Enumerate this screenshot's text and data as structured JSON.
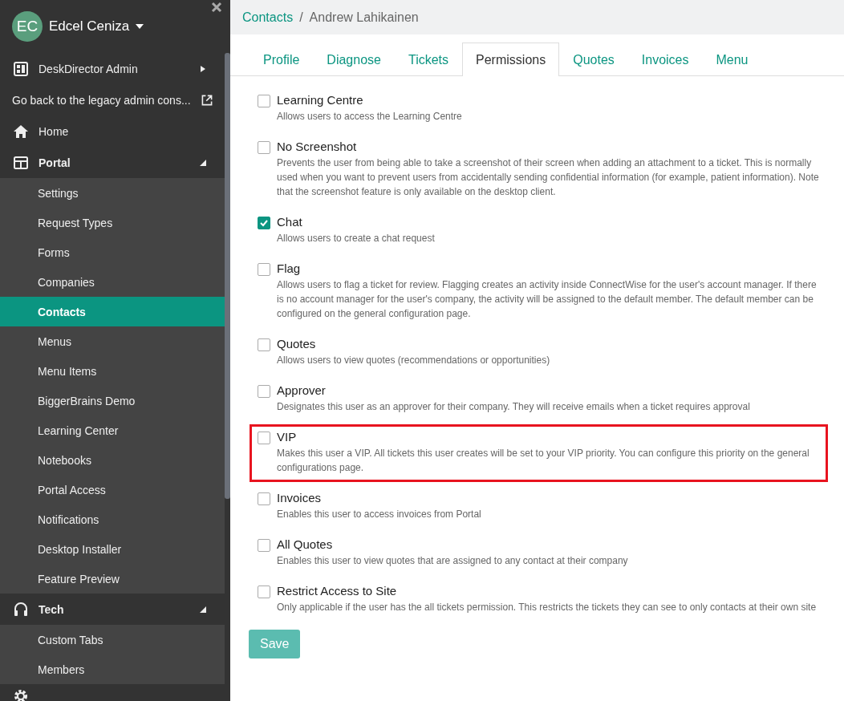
{
  "sidebar": {
    "user": {
      "initials": "EC",
      "name": "Edcel Ceniza"
    },
    "items": [
      {
        "kind": "submenu",
        "label": "DeskDirector Admin"
      },
      {
        "kind": "external",
        "label": "Go back to the legacy admin cons..."
      },
      {
        "kind": "link",
        "label": "Home"
      },
      {
        "kind": "section",
        "label": "Portal",
        "expanded": true,
        "children": [
          {
            "label": "Settings",
            "selected": false
          },
          {
            "label": "Request Types",
            "selected": false
          },
          {
            "label": "Forms",
            "selected": false
          },
          {
            "label": "Companies",
            "selected": false
          },
          {
            "label": "Contacts",
            "selected": true
          },
          {
            "label": "Menus",
            "selected": false
          },
          {
            "label": "Menu Items",
            "selected": false
          },
          {
            "label": "BiggerBrains Demo",
            "selected": false
          },
          {
            "label": "Learning Center",
            "selected": false
          },
          {
            "label": "Notebooks",
            "selected": false
          },
          {
            "label": "Portal Access",
            "selected": false
          },
          {
            "label": "Notifications",
            "selected": false
          },
          {
            "label": "Desktop Installer",
            "selected": false
          },
          {
            "label": "Feature Preview",
            "selected": false
          }
        ]
      },
      {
        "kind": "section",
        "label": "Tech",
        "expanded": true,
        "children": [
          {
            "label": "Custom Tabs",
            "selected": false
          },
          {
            "label": "Members",
            "selected": false
          }
        ]
      }
    ]
  },
  "breadcrumb": {
    "link": "Contacts",
    "separator": "/",
    "current": "Andrew Lahikainen"
  },
  "tabs": [
    {
      "label": "Profile",
      "selected": false
    },
    {
      "label": "Diagnose",
      "selected": false
    },
    {
      "label": "Tickets",
      "selected": false
    },
    {
      "label": "Permissions",
      "selected": true
    },
    {
      "label": "Quotes",
      "selected": false
    },
    {
      "label": "Invoices",
      "selected": false
    },
    {
      "label": "Menu",
      "selected": false
    }
  ],
  "permissions": [
    {
      "title": "Learning Centre",
      "description": "Allows users to access the Learning Centre",
      "checked": false,
      "highlighted": false
    },
    {
      "title": "No Screenshot",
      "description": "Prevents the user from being able to take a screenshot of their screen when adding an attachment to a ticket. This is normally used when you want to prevent users from accidentally sending confidential information (for example, patient information). Note that the screenshot feature is only available on the desktop client.",
      "checked": false,
      "highlighted": false
    },
    {
      "title": "Chat",
      "description": "Allows users to create a chat request",
      "checked": true,
      "highlighted": false
    },
    {
      "title": "Flag",
      "description": "Allows users to flag a ticket for review. Flagging creates an activity inside ConnectWise for the user's account manager. If there is no account manager for the user's company, the activity will be assigned to the default member. The default member can be configured on the general configuration page.",
      "checked": false,
      "highlighted": false
    },
    {
      "title": "Quotes",
      "description": "Allows users to view quotes (recommendations or opportunities)",
      "checked": false,
      "highlighted": false
    },
    {
      "title": "Approver",
      "description": "Designates this user as an approver for their company. They will receive emails when a ticket requires approval",
      "checked": false,
      "highlighted": false
    },
    {
      "title": "VIP",
      "description": "Makes this user a VIP. All tickets this user creates will be set to your VIP priority. You can configure this priority on the general configurations page.",
      "checked": false,
      "highlighted": true
    },
    {
      "title": "Invoices",
      "description": "Enables this user to access invoices from Portal",
      "checked": false,
      "highlighted": false
    },
    {
      "title": "All Quotes",
      "description": "Enables this user to view quotes that are assigned to any contact at their company",
      "checked": false,
      "highlighted": false
    },
    {
      "title": "Restrict Access to Site",
      "description": "Only applicable if the user has the all tickets permission. This restricts the tickets they can see to only contacts at their own site",
      "checked": false,
      "highlighted": false
    }
  ],
  "save_button": "Save"
}
